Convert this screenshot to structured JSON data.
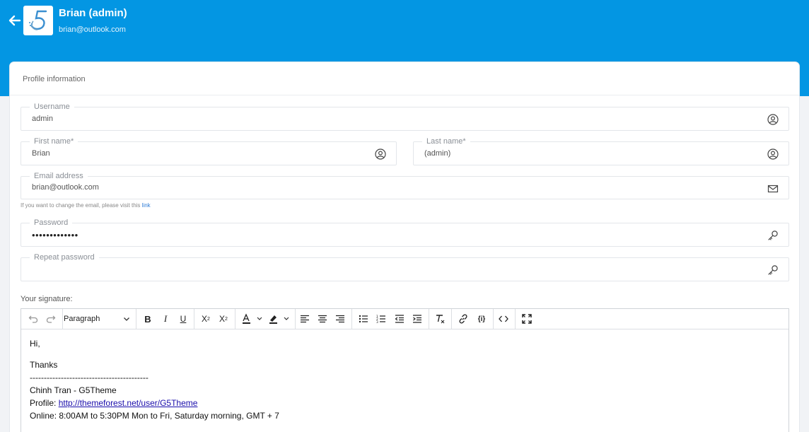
{
  "header": {
    "user_name": "Brian (admin)",
    "user_email": "brian@outlook.com"
  },
  "card": {
    "title": "Profile information"
  },
  "fields": {
    "username": {
      "label": "Username",
      "value": "admin"
    },
    "first_name": {
      "label": "First name*",
      "value": "Brian"
    },
    "last_name": {
      "label": "Last name*",
      "value": "(admin)"
    },
    "email": {
      "label": "Email address",
      "value": "brian@outlook.com"
    },
    "password": {
      "label": "Password",
      "value": "•••••••••••••"
    },
    "repeat_password": {
      "label": "Repeat password",
      "value": ""
    }
  },
  "email_hint": {
    "text": "If you want to change the email, please visit this ",
    "link": "link"
  },
  "signature": {
    "label": "Your signature:",
    "block_format": "Paragraph",
    "lines": {
      "greeting": "Hi,",
      "thanks": "Thanks",
      "divider": "------------------------------------------",
      "name": "Chinh Tran - G5Theme",
      "profile_label": "Profile: ",
      "profile_url": "http://themeforest.net/user/G5Theme",
      "online": "Online: 8:00AM to 5:30PM Mon to Fri, Saturday morning, GMT + 7"
    }
  }
}
